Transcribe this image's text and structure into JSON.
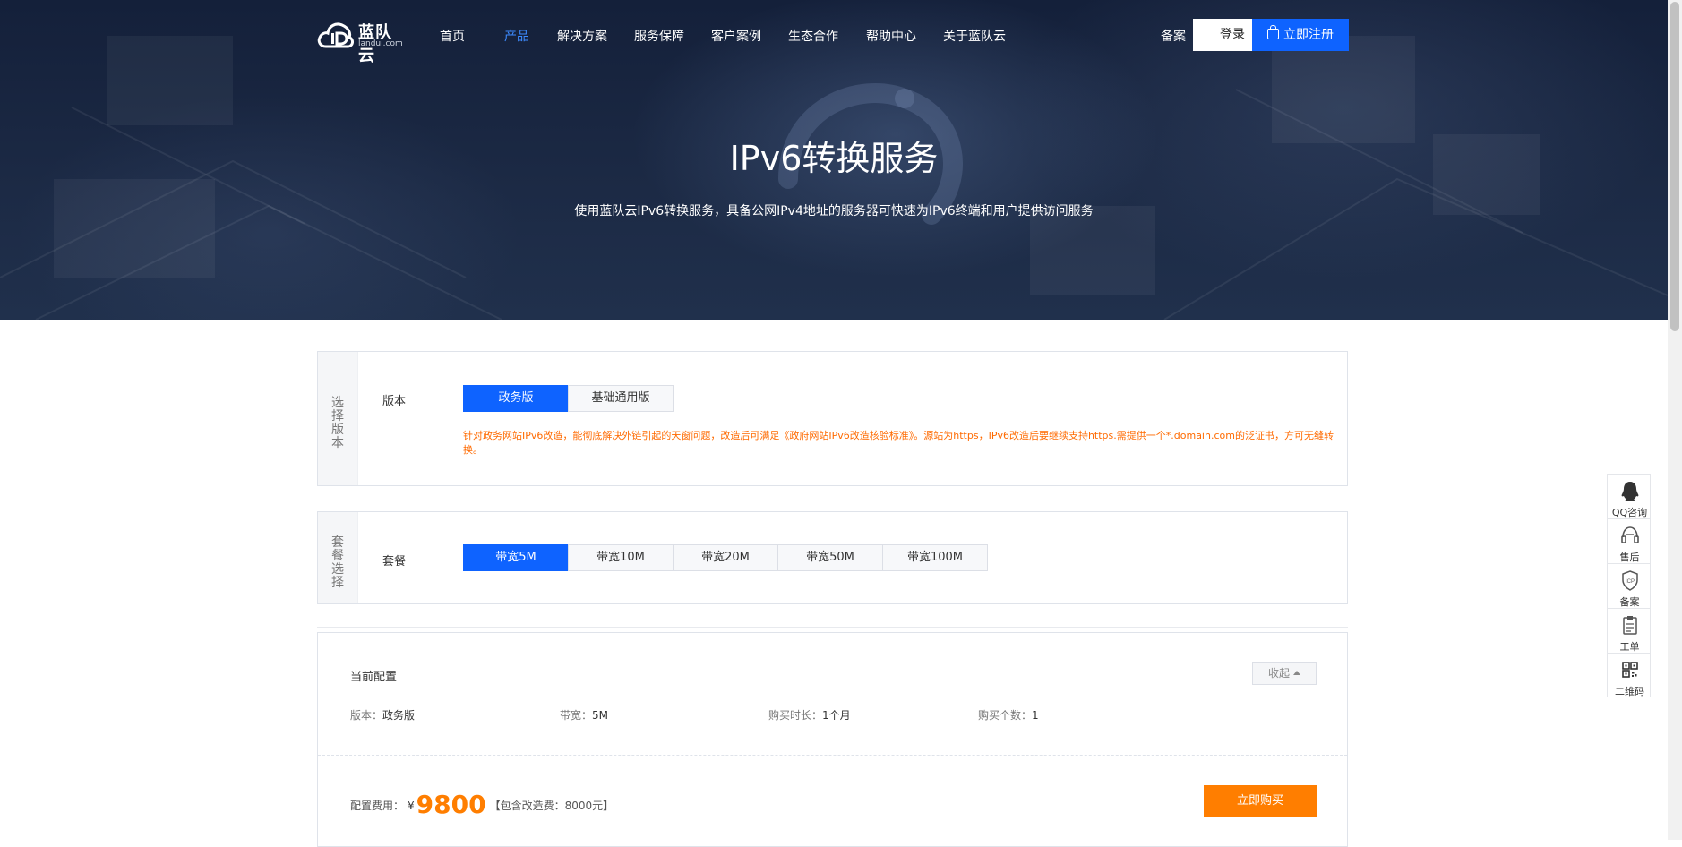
{
  "brand": {
    "name": "蓝队云",
    "domain": "landui.com"
  },
  "nav": {
    "items": [
      {
        "label": "首页",
        "active": false
      },
      {
        "label": "产品",
        "active": true
      },
      {
        "label": "解决方案",
        "active": false
      },
      {
        "label": "服务保障",
        "active": false
      },
      {
        "label": "客户案例",
        "active": false
      },
      {
        "label": "生态合作",
        "active": false
      },
      {
        "label": "帮助中心",
        "active": false
      },
      {
        "label": "关于蓝队云",
        "active": false
      }
    ],
    "beian": "备案",
    "login": "登录",
    "register": "立即注册"
  },
  "hero": {
    "title": "IPv6转换服务",
    "subtitle": "使用蓝队云IPv6转换服务，具备公网IPv4地址的服务器可快速为IPv6终端和用户提供访问服务"
  },
  "version_panel": {
    "side_label": "选择版本",
    "row_label": "版本",
    "options": [
      {
        "label": "政务版",
        "selected": true
      },
      {
        "label": "基础通用版",
        "selected": false
      }
    ],
    "note": "针对政务网站IPv6改造，能彻底解决外链引起的天窗问题，改造后可满足《政府网站IPv6改造核验标准》。源站为https，IPv6改造后要继续支持https.需提供一个*.domain.com的泛证书，方可无缝转换。"
  },
  "package_panel": {
    "side_label": "套餐选择",
    "row_label": "套餐",
    "options": [
      {
        "label": "带宽5M",
        "selected": true
      },
      {
        "label": "带宽10M",
        "selected": false
      },
      {
        "label": "带宽20M",
        "selected": false
      },
      {
        "label": "带宽50M",
        "selected": false
      },
      {
        "label": "带宽100M",
        "selected": false
      }
    ]
  },
  "config": {
    "title": "当前配置",
    "collapse": "收起",
    "items": [
      {
        "label": "版本：",
        "value": "政务版"
      },
      {
        "label": "带宽：",
        "value": "5M"
      },
      {
        "label": "购买时长：",
        "value": "1个月"
      },
      {
        "label": "购买个数：",
        "value": "1"
      }
    ],
    "fee_label": "配置费用：",
    "currency": "¥",
    "price": "9800",
    "includes": "【包含改造费：8000元】",
    "buy": "立即购买"
  },
  "float_bar": [
    {
      "icon": "qq-icon",
      "label": "QQ咨询"
    },
    {
      "icon": "headset-icon",
      "label": "售后"
    },
    {
      "icon": "icp-shield-icon",
      "label": "备案"
    },
    {
      "icon": "clipboard-icon",
      "label": "工单"
    },
    {
      "icon": "qrcode-icon",
      "label": "二维码"
    }
  ],
  "colors": {
    "primary": "#0e63ff",
    "accent": "#ff7e00",
    "note": "#ff6a00",
    "hero_bg": "#1c2a45"
  }
}
